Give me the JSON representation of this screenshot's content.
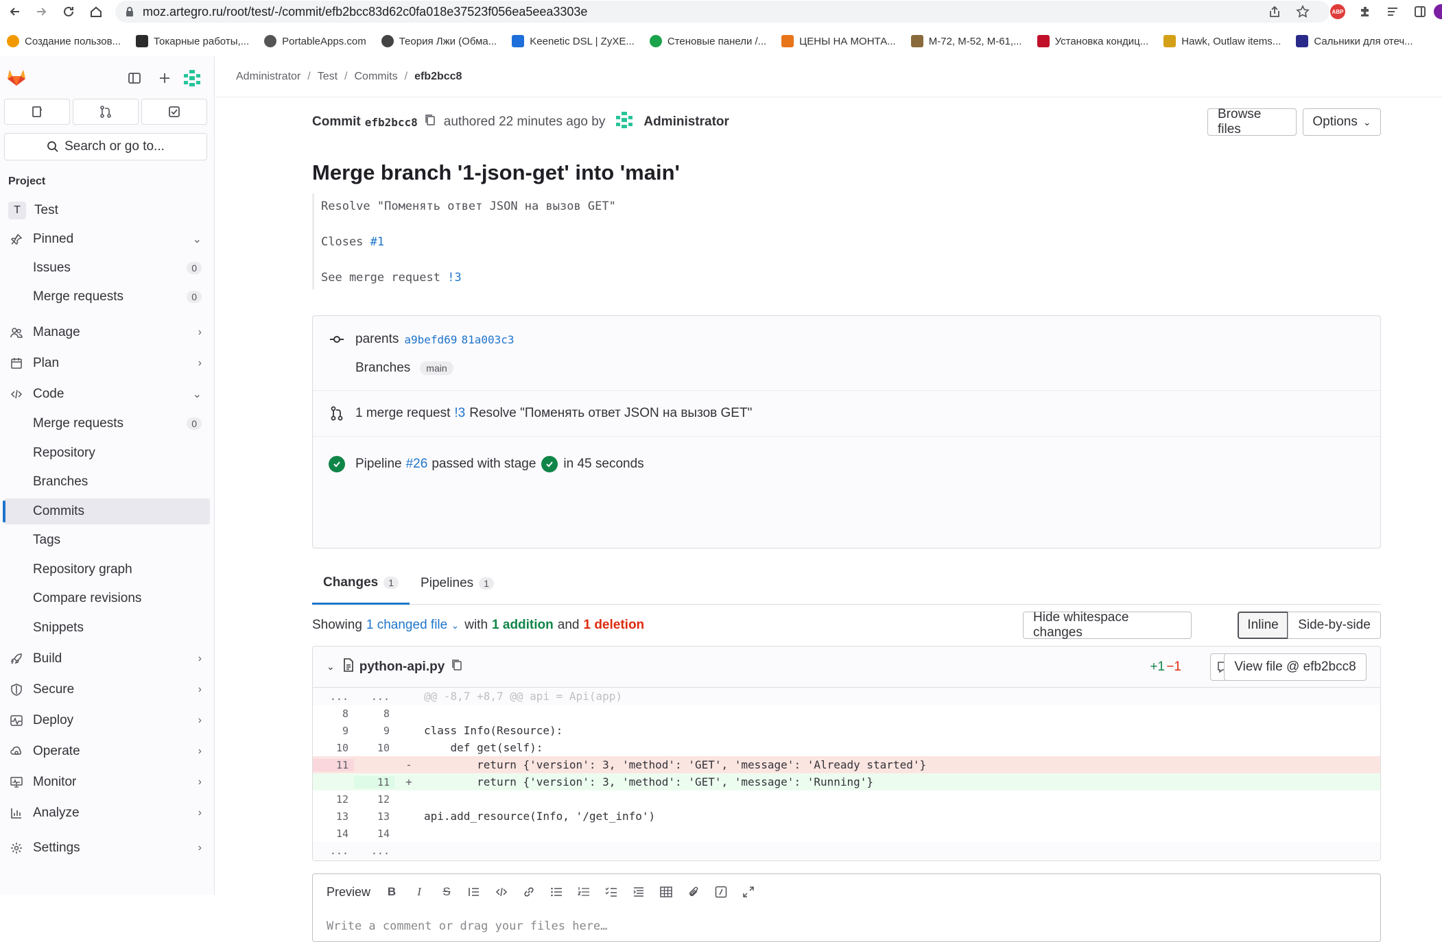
{
  "browser": {
    "url": "moz.artegro.ru/root/test/-/commit/efb2bcc83d62c0fa018e37523f056ea5eea3303e",
    "bookmarks": [
      {
        "label": "Создание пользов...",
        "color": "#f29900"
      },
      {
        "label": "Токарные работы,...",
        "color": "#2b2b2b"
      },
      {
        "label": "PortableApps.com",
        "color": "#555555"
      },
      {
        "label": "Теория Лжи (Обма...",
        "color": "#444444"
      },
      {
        "label": "Keenetic DSL | ZyXE...",
        "color": "#1e6fd9"
      },
      {
        "label": "Стеновые панели /...",
        "color": "#1aa34a"
      },
      {
        "label": "ЦЕНЫ НА МОНТА...",
        "color": "#e8751a"
      },
      {
        "label": "М-72, М-52, М-61,...",
        "color": "#8a6a3a"
      },
      {
        "label": "Установка кондиц...",
        "color": "#c0102a"
      },
      {
        "label": "Hawk, Outlaw items...",
        "color": "#d4a017"
      },
      {
        "label": "Сальники для отеч...",
        "color": "#2a2a8a"
      }
    ]
  },
  "sidebar": {
    "search": "Search or go to...",
    "section": "Project",
    "project": {
      "avatar": "T",
      "name": "Test"
    },
    "pinned": "Pinned",
    "pinned_items": [
      {
        "label": "Issues",
        "count": "0"
      },
      {
        "label": "Merge requests",
        "count": "0"
      }
    ],
    "groups": {
      "manage": "Manage",
      "plan": "Plan",
      "code": "Code",
      "build": "Build",
      "secure": "Secure",
      "deploy": "Deploy",
      "operate": "Operate",
      "monitor": "Monitor",
      "analyze": "Analyze",
      "settings": "Settings"
    },
    "code_items": [
      {
        "label": "Merge requests",
        "count": "0"
      },
      {
        "label": "Repository"
      },
      {
        "label": "Branches"
      },
      {
        "label": "Commits"
      },
      {
        "label": "Tags"
      },
      {
        "label": "Repository graph"
      },
      {
        "label": "Compare revisions"
      },
      {
        "label": "Snippets"
      }
    ]
  },
  "breadcrumb": [
    "Administrator",
    "Test",
    "Commits",
    "efb2bcc8"
  ],
  "commit": {
    "label": "Commit",
    "sha": "efb2bcc8",
    "authored": "authored 22 minutes ago by",
    "author": "Administrator",
    "browse_files": "Browse files",
    "options": "Options",
    "title": "Merge branch '1-json-get' into 'main'",
    "desc_line1": "Resolve \"Поменять ответ JSON на вызов GET\"",
    "desc_line2_prefix": "Closes",
    "desc_line2_link": "#1",
    "desc_line3_prefix": "See merge request",
    "desc_line3_link": "!3"
  },
  "info": {
    "parents_label": "parents",
    "parent1": "a9befd69",
    "parent2": "81a003c3",
    "branches_label": "Branches",
    "branch": "main",
    "mr_prefix": "1 merge request",
    "mr_link": "!3",
    "mr_title": "Resolve \"Поменять ответ JSON на вызов GET\"",
    "pipeline_label": "Pipeline",
    "pipeline_link": "#26",
    "pipeline_status": "passed with stage",
    "pipeline_time": "in 45 seconds"
  },
  "tabs": [
    {
      "label": "Changes",
      "count": "1"
    },
    {
      "label": "Pipelines",
      "count": "1"
    }
  ],
  "showing": {
    "prefix": "Showing",
    "changed": "1 changed file",
    "with": "with",
    "additions": "1 addition",
    "and": "and",
    "deletions": "1 deletion",
    "hide_ws": "Hide whitespace changes",
    "inline": "Inline",
    "side": "Side-by-side"
  },
  "diff": {
    "file": "python-api.py",
    "plus": "+1",
    "minus": "−1",
    "view_file": "View file @ efb2bcc8",
    "hunk": "@@ -8,7 +8,7 @@ api = Api(app)",
    "lines": [
      {
        "old": "8",
        "new": "8",
        "code": ""
      },
      {
        "old": "9",
        "new": "9",
        "code": "class Info(Resource):"
      },
      {
        "old": "10",
        "new": "10",
        "code": "    def get(self):"
      },
      {
        "old": "12",
        "new": "12",
        "code": ""
      },
      {
        "old": "13",
        "new": "13",
        "code": "api.add_resource(Info, '/get_info')"
      },
      {
        "old": "14",
        "new": "14",
        "code": ""
      }
    ],
    "del_line": {
      "old": "11",
      "marker": "-",
      "code": "        return {'version': 3, 'method': 'GET', 'message': 'Already started'}"
    },
    "add_line": {
      "new": "11",
      "marker": "+",
      "code": "        return {'version': 3, 'method': 'GET', 'message': 'Running'}"
    },
    "ellipsis": "..."
  },
  "editor": {
    "preview": "Preview",
    "placeholder": "Write a comment or drag your files here…"
  }
}
